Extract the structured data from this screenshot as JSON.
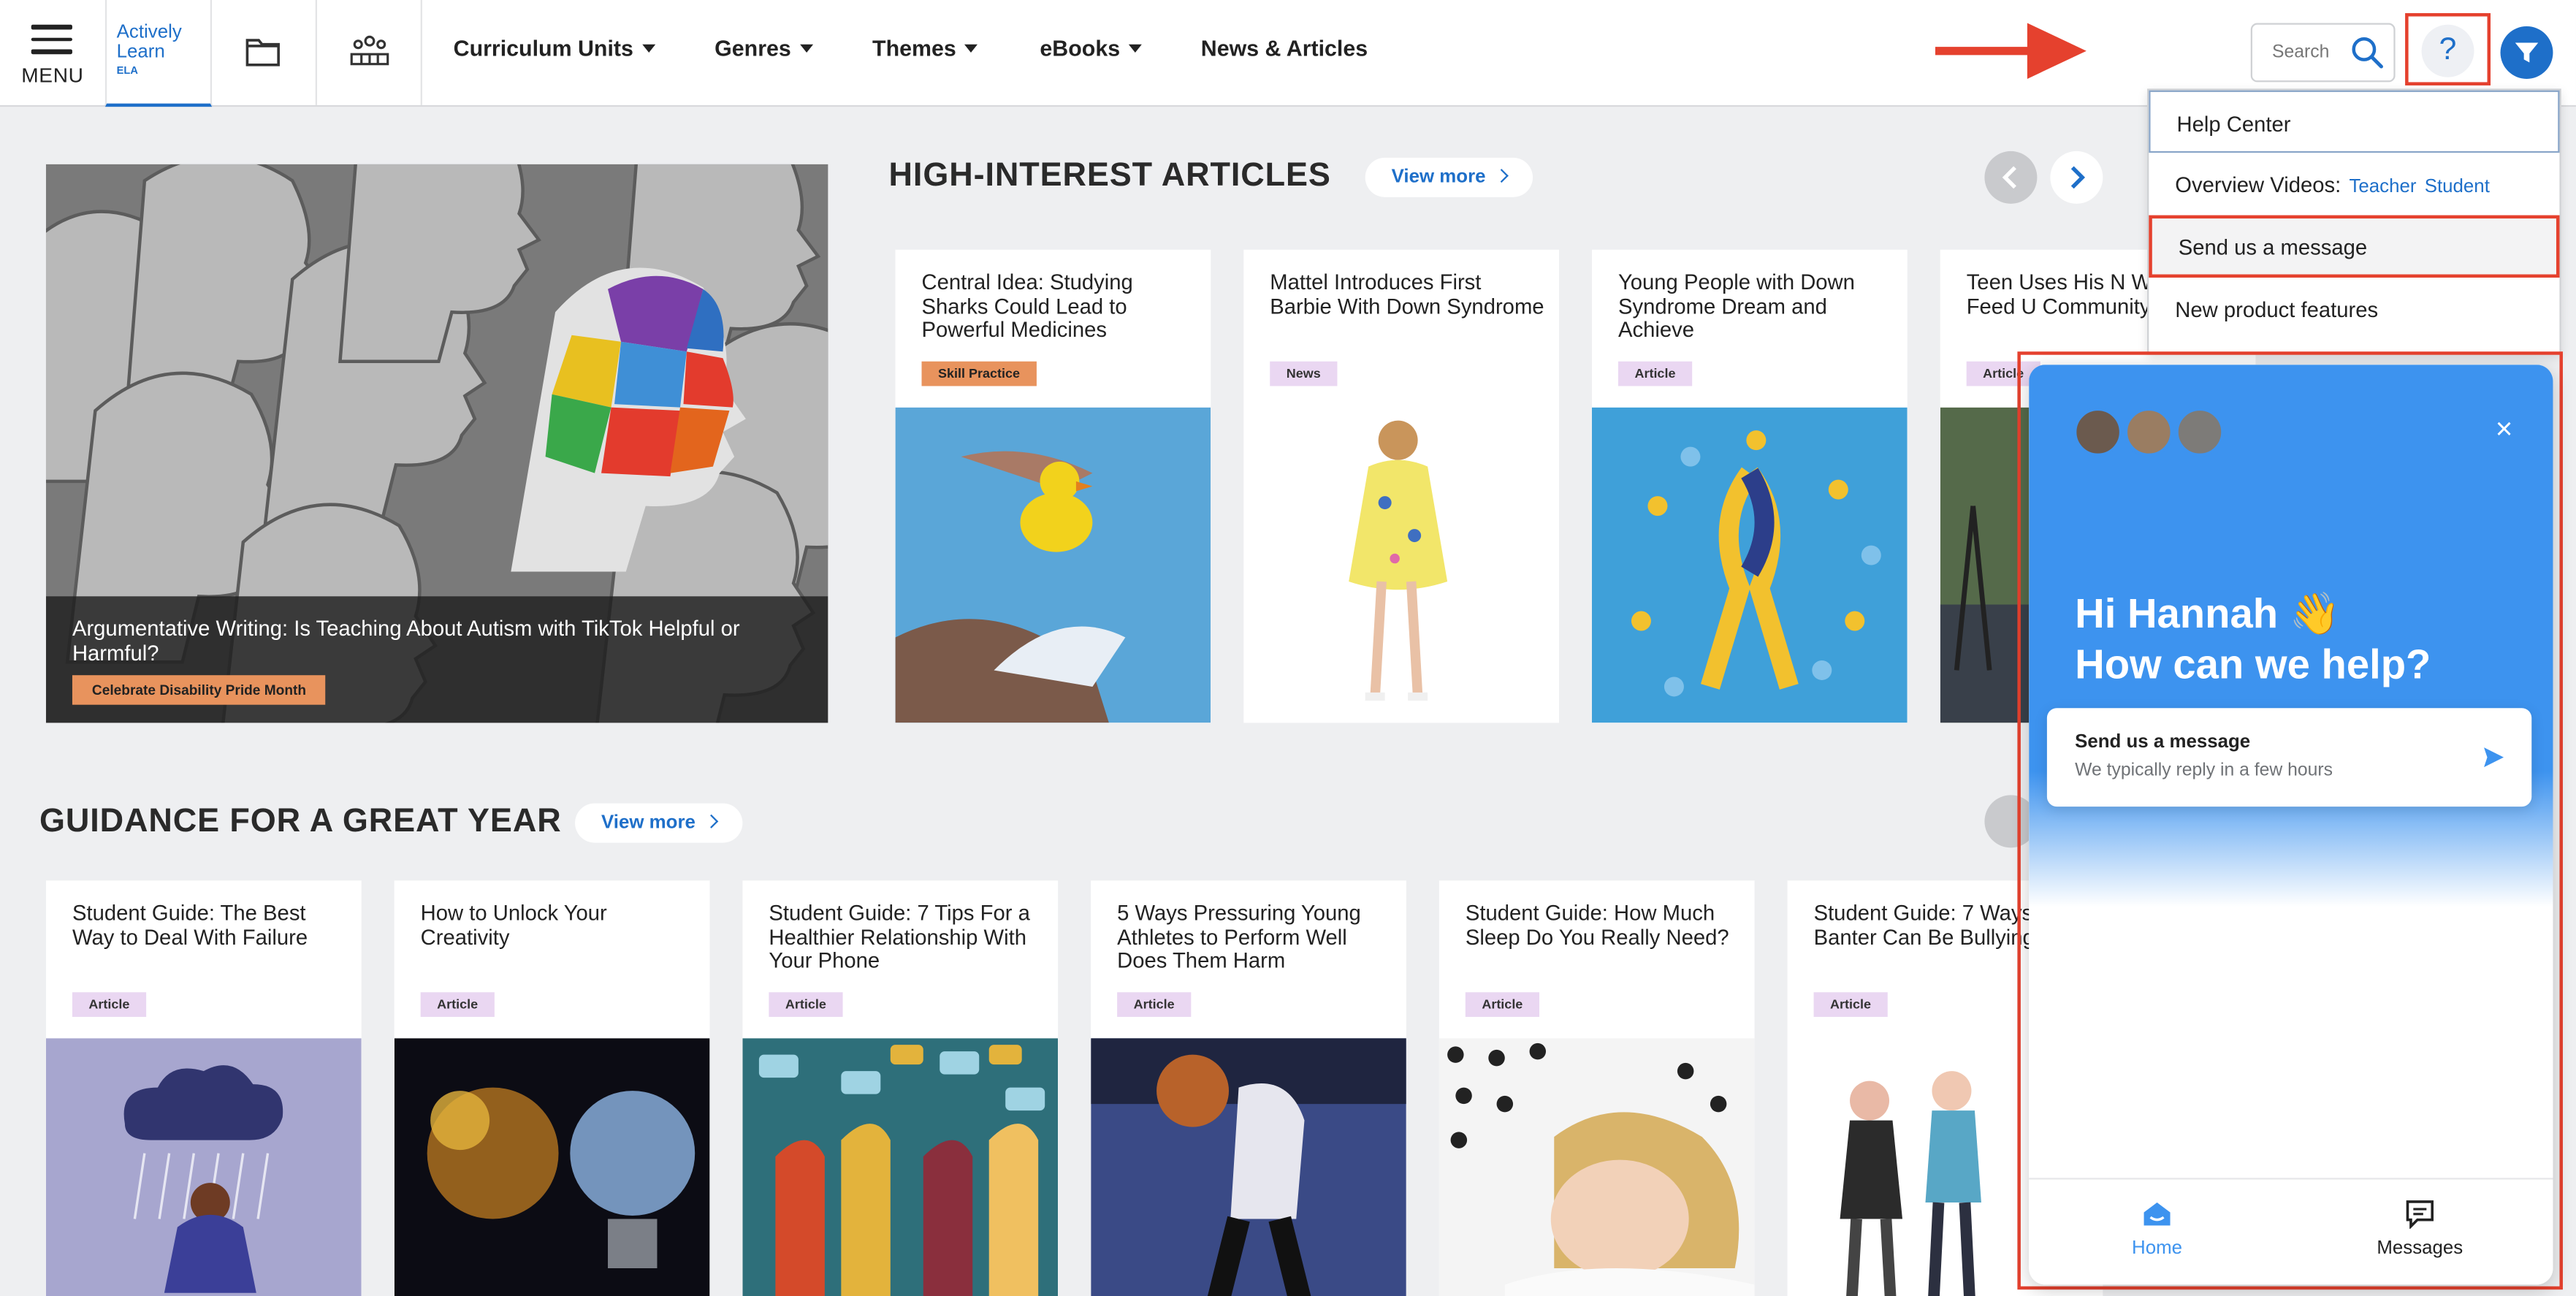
{
  "header": {
    "menu_label": "MENU",
    "logo_line1": "Actively",
    "logo_line2": "Learn",
    "logo_tag": "ELA",
    "nav": [
      {
        "label": "Curriculum Units"
      },
      {
        "label": "Genres"
      },
      {
        "label": "Themes"
      },
      {
        "label": "eBooks"
      },
      {
        "label": "News & Articles"
      }
    ],
    "search_placeholder": "Search",
    "help_glyph": "?"
  },
  "icons": {
    "folder": "folder-icon",
    "classes": "classroom-icon",
    "search": "search-icon",
    "filter": "filter-icon",
    "annotation_arrow": "arrow-right-icon"
  },
  "colors": {
    "accent": "#1e6fc9",
    "annotation": "#e5412e",
    "chat_blue": "#3d93ef",
    "badge_orange": "#e8935d",
    "badge_lilac": "#ead7f2"
  },
  "hero": {
    "title": "Argumentative Writing: Is Teaching About Autism with TikTok Helpful or Harmful?",
    "badge": "Celebrate Disability Pride Month"
  },
  "high_interest": {
    "title": "HIGH-INTEREST ARTICLES",
    "view_more": "View more",
    "cards": [
      {
        "title": "Central Idea: Studying Sharks Could Lead to Powerful Medicines",
        "badge": "Skill Practice"
      },
      {
        "title": "Mattel Introduces First Barbie With Down Syndrome",
        "badge": "News"
      },
      {
        "title": "Young People with Down Syndrome Dream and Achieve",
        "badge": "Article"
      },
      {
        "title": "Teen Uses His N Wish to Feed U Community",
        "badge": "Article"
      }
    ]
  },
  "guidance": {
    "title": "GUIDANCE FOR A GREAT YEAR",
    "view_more": "View more",
    "cards": [
      {
        "title": "Student Guide: The Best Way to Deal With Failure",
        "badge": "Article"
      },
      {
        "title": "How to Unlock Your Creativity",
        "badge": "Article"
      },
      {
        "title": "Student Guide: 7 Tips For a Healthier Relationship With Your Phone",
        "badge": "Article"
      },
      {
        "title": "5 Ways Pressuring Young Athletes to Perform Well Does Them Harm",
        "badge": "Article"
      },
      {
        "title": "Student Guide: How Much Sleep Do You Really Need?",
        "badge": "Article"
      },
      {
        "title": "Student Guide: 7 Ways That Banter Can Be Bullying",
        "badge": "Article"
      }
    ]
  },
  "help_menu": {
    "help_center": "Help Center",
    "overview_label": "Overview Videos:",
    "overview_teacher": "Teacher",
    "overview_student": "Student",
    "send_message": "Send us a message",
    "new_features": "New product features"
  },
  "chat": {
    "greeting_line1": "Hi Hannah 👋",
    "greeting_line2": "How can we help?",
    "card_title": "Send us a message",
    "card_subtitle": "We typically reply in a few hours",
    "tab_home": "Home",
    "tab_messages": "Messages",
    "close_glyph": "×"
  }
}
